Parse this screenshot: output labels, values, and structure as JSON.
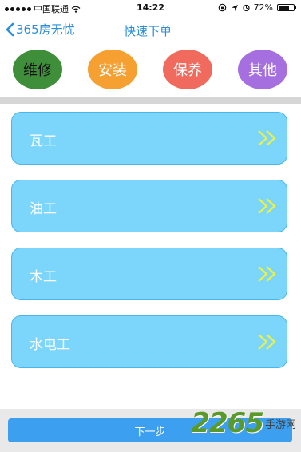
{
  "status": {
    "carrier": "中国联通",
    "time": "14:22",
    "battery": "72%",
    "battery_level": 0.72
  },
  "nav": {
    "back_label": "365房无忧",
    "title": "快速下单"
  },
  "categories": [
    {
      "label": "维修",
      "color": "#3f8f3a",
      "active": true
    },
    {
      "label": "安装",
      "color": "#f5a030",
      "active": false
    },
    {
      "label": "保养",
      "color": "#f06a5e",
      "active": false
    },
    {
      "label": "其他",
      "color": "#a56fe0",
      "active": false
    }
  ],
  "items": [
    {
      "label": "瓦工"
    },
    {
      "label": "油工"
    },
    {
      "label": "木工"
    },
    {
      "label": "水电工"
    }
  ],
  "footer": {
    "next_label": "下一步"
  },
  "watermark": {
    "number": "2265",
    "text": "手游网"
  },
  "colors": {
    "accent": "#2a8fd8",
    "item_bg": "#7cd6fb",
    "chevron": "#e8f04a"
  }
}
